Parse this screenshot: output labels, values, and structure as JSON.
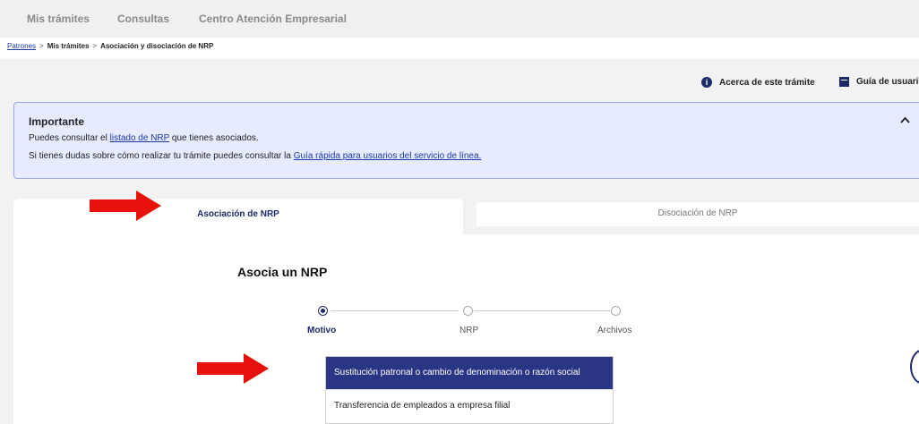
{
  "topnav": {
    "items": [
      "Mis trámites",
      "Consultas",
      "Centro Atención Empresarial"
    ]
  },
  "breadcrumb": {
    "root": "Patrones",
    "level1": "Mis trámites",
    "current": "Asociación y disociación de NRP",
    "separator": ">"
  },
  "help": {
    "about": "Acerca de este trámite",
    "guide": "Guía de usuari",
    "about_icon": "info-icon",
    "guide_icon": "book-icon"
  },
  "notice": {
    "title": "Importante",
    "line1_prefix": "Puedes consultar el ",
    "line1_link": "listado de NRP",
    "line1_suffix": " que tienes asociados.",
    "line2_prefix": "Si tienes dudas sobre cómo realizar tu trámite puedes consultar la ",
    "line2_link": "Guía rápida para usuarios del servicio de línea.",
    "collapse_icon": "chevron-up-icon"
  },
  "tabs": [
    {
      "label": "Asociación de NRP",
      "active": true
    },
    {
      "label": "Disociación de NRP",
      "active": false
    }
  ],
  "form": {
    "title": "Asocia un NRP"
  },
  "stepper": [
    {
      "label": "Motivo",
      "active": true
    },
    {
      "label": "NRP",
      "active": false
    },
    {
      "label": "Archivos",
      "active": false
    }
  ],
  "options": [
    {
      "label": "Sustitución patronal o cambio de denominación o razón social",
      "selected": true
    },
    {
      "label": "Transferencia de empleados a empresa filial",
      "selected": false
    }
  ],
  "colors": {
    "primary": "#1d2a6a",
    "selected_option": "#2a3683",
    "annotation_arrow": "#e8120c",
    "notice_bg": "#e6ebff"
  }
}
